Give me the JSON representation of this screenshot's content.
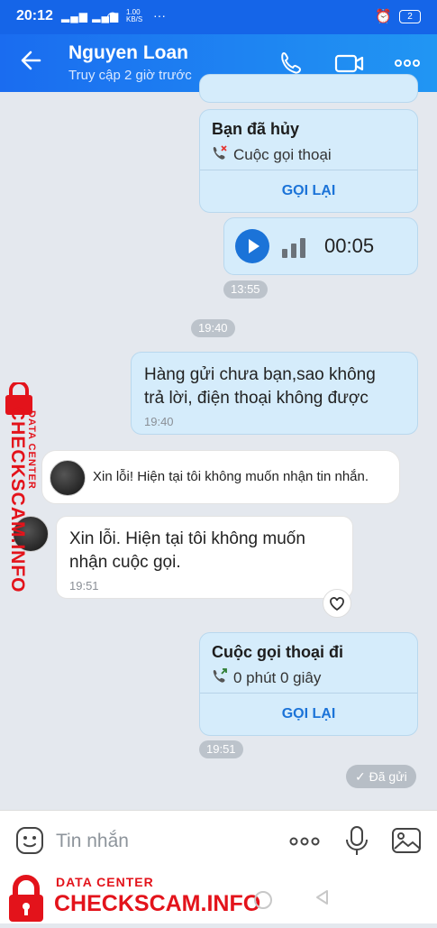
{
  "status_bar": {
    "time": "20:12",
    "speed": "1.00 KB/S",
    "battery": "2"
  },
  "header": {
    "name": "Nguyen Loan",
    "status": "Truy cập 2 giờ trước"
  },
  "messages": {
    "call1": {
      "title": "Bạn đã hủy",
      "subtitle": "Cuộc gọi thoại",
      "action": "GỌI LẠI"
    },
    "voice": {
      "duration": "00:05",
      "time": "13:55"
    },
    "divider_time": "19:40",
    "outgoing": {
      "text_line1": "Hàng gửi chưa bạn,sao không",
      "text_line2": "trả lời, điện thoại không được",
      "time": "19:40"
    },
    "auto_reply": "Xin lỗi! Hiện tại tôi không muốn nhận tin nhắn.",
    "incoming": {
      "text_line1": "Xin lỗi. Hiện tại tôi không muốn",
      "text_line2": "nhận cuộc gọi.",
      "time": "19:51"
    },
    "call2": {
      "title": "Cuộc gọi thoại đi",
      "subtitle": "0 phút 0 giây",
      "action": "GỌI LẠI",
      "time": "19:51"
    },
    "sent_status": "Đã gửi"
  },
  "composer": {
    "placeholder": "Tin nhắn"
  },
  "watermark": {
    "small": "DATA CENTER",
    "big": "CHECKSCAM.INFO"
  },
  "colors": {
    "header": "#1a6cf0",
    "accent": "#1b73d8",
    "bubble_out": "#d5ecfb"
  }
}
